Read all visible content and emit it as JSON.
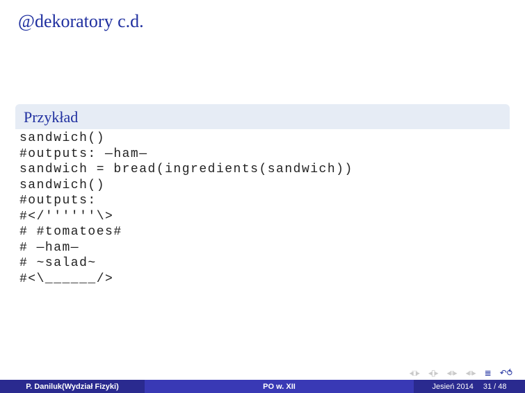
{
  "title": "@dekoratory c.d.",
  "example": {
    "heading": "Przykład",
    "code": "sandwich()\n#outputs: —ham—\nsandwich = bread(ingredients(sandwich))\nsandwich()\n#outputs:\n#</''''''\\>\n# #tomatoes#\n# —ham—\n# ~salad~\n#<\\______/>"
  },
  "nav": {
    "first": "◂□▸",
    "prevsec": "◂▯▸",
    "prev": "◂≡▸",
    "next": "◂≡▸",
    "target": "≣",
    "undo": "↶⥀"
  },
  "footer": {
    "author": "P. Daniluk(Wydział Fizyki)",
    "center": "PO w. XII",
    "date": "Jesień 2014",
    "page": "31 / 48"
  }
}
